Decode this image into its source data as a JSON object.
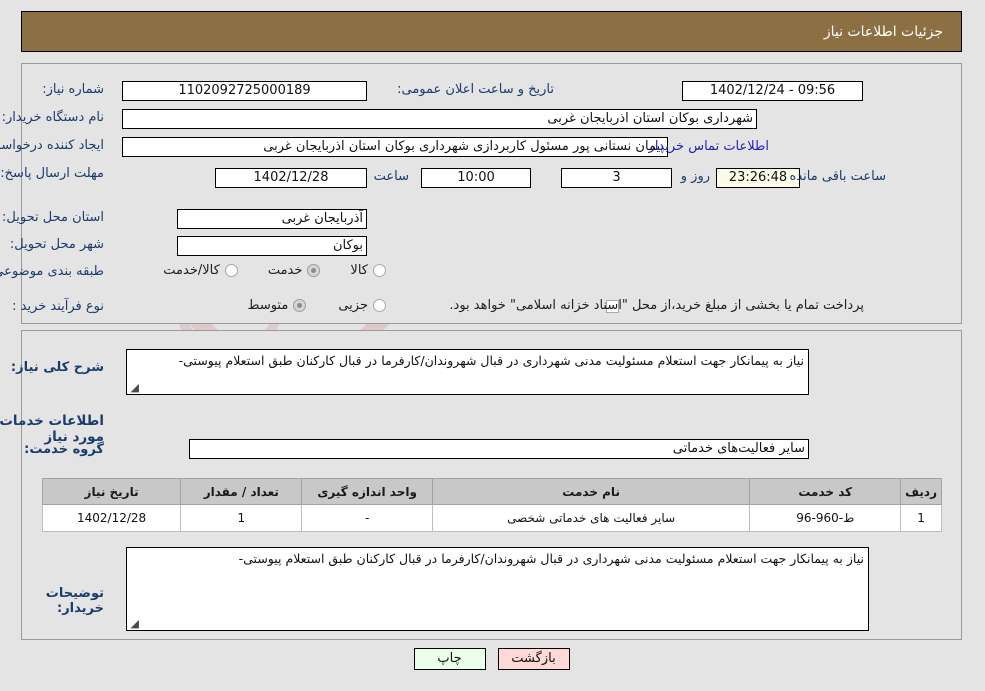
{
  "header": {
    "title": "جزئیات اطلاعات نیاز"
  },
  "watermark": {
    "text": "AriaTender.net"
  },
  "top_panel": {
    "need_number": {
      "label": "شماره نیاز:",
      "value": "1102092725000189"
    },
    "announce_datetime": {
      "label": "تاریخ و ساعت اعلان عمومی:",
      "value": "09:56 - 1402/12/24"
    },
    "buyer_org": {
      "label": "نام دستگاه خریدار:",
      "value": "شهرداری بوکان استان اذربایجان غربی"
    },
    "requester": {
      "label": "ایجاد کننده درخواست:",
      "value": "پیمان نستانی پور مسئول کاربردازی شهرداری بوکان استان اذربایجان غربی"
    },
    "contact_link": "اطلاعات تماس خریدار",
    "deadline": {
      "label": "مهلت ارسال پاسخ: تا تاریخ:",
      "date": "1402/12/28",
      "time_label": "ساعت",
      "time": "10:00",
      "days": "3",
      "days_label": "روز و",
      "countdown": "23:26:48",
      "countdown_label": "ساعت باقی مانده"
    },
    "province": {
      "label": "استان محل تحویل:",
      "value": "آذربایجان غربی"
    },
    "city": {
      "label": "شهر محل تحویل:",
      "value": "بوکان"
    },
    "category": {
      "label": "طبقه بندی موضوعی:",
      "options": [
        "کالا",
        "خدمت",
        "کالا/خدمت"
      ],
      "selected": "خدمت"
    },
    "purchase_type": {
      "label": "نوع فرآیند خرید :",
      "options": [
        "جزیی",
        "متوسط"
      ],
      "selected": "متوسط"
    },
    "treasury_note": {
      "checked": false,
      "text": "پرداخت تمام یا بخشی از مبلغ خرید،از محل \"اسناد خزانه اسلامی\" خواهد بود."
    }
  },
  "mid_panel": {
    "general_desc": {
      "label": "شرح کلی نیاز:",
      "value": "نیاز به پیمانکار جهت استعلام مسئولیت مدنی شهرداری در قبال شهروندان/کارفرما در قبال کارکنان طبق استعلام پیوستی-"
    },
    "services_heading": "اطلاعات خدمات مورد نیاز",
    "service_group": {
      "label": "گروه خدمت:",
      "value": "سایر فعالیت‌های خدماتی"
    },
    "table": {
      "columns": [
        "ردیف",
        "کد خدمت",
        "نام خدمت",
        "واحد اندازه گیری",
        "تعداد / مقدار",
        "تاریخ نیاز"
      ],
      "rows": [
        {
          "row_no": "1",
          "service_code": "ط-960-96",
          "service_name": "سایر فعالیت های خدماتی شخصی",
          "unit": "-",
          "quantity": "1",
          "need_date": "1402/12/28"
        }
      ]
    },
    "buyer_remarks": {
      "label": "توضیحات خریدار:",
      "value": "نیاز به پیمانکار جهت استعلام مسئولیت مدنی شهرداری در قبال شهروندان/کارفرما در قبال کارکنان طبق استعلام پیوستی-"
    }
  },
  "buttons": {
    "print": "چاپ",
    "back": "بازگشت"
  },
  "colors": {
    "header_bg": "#8c6f42",
    "label_blue": "#1a3c6e",
    "link_blue": "#2323b4",
    "print_btn": "#eaffea",
    "back_btn": "#ffd8d8",
    "table_header": "#c8c8c8"
  }
}
